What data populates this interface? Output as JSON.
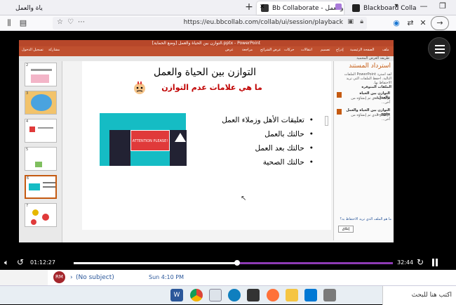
{
  "browser": {
    "tabs": [
      {
        "label": "ياة والعمل"
      },
      {
        "label": "Bb Collaborate - ياة والعمل"
      },
      {
        "label": "Blackboard Collaborate Ultra -"
      }
    ],
    "url": "https://eu.bbcollab.com/collab/ui/session/playback",
    "new_tab": "+"
  },
  "powerpoint": {
    "title_bar": "[وضع الحماية] التوازن بين الحياة والعمل.pptx - PowerPoint",
    "ribbon_tabs": [
      "ملف",
      "الصفحة الرئيسية",
      "إدراج",
      "تصميم",
      "انتقالات",
      "حركات",
      "عرض الشرائح",
      "مراجعة",
      "عرض"
    ],
    "ribbon_right": "تسجيل الدخول",
    "ribbon_share": "مشاركة",
    "protected_view": "طريقة العرض المحمية",
    "thumb_numbers": [
      "2",
      "3",
      "4",
      "5",
      "6",
      "7"
    ],
    "slide": {
      "title": "التوازن بين الحياة والعمل",
      "subtitle": "ما هي علامات عدم التوازن",
      "bullets": [
        "تعليقات الأهل وزملاء العمل",
        "حالتك بالعمل",
        "حالتك بعد العمل",
        "حالتك الصحية"
      ],
      "sign_text": "ATTENTION PLEASE!"
    },
    "pane": {
      "title": "استرداد المستند",
      "desc": "لقد استرد PowerPoint الملفات التالية. احفظ الملفات التي تريد الاحتفاظ بها.",
      "section": "الملفات المتوفرة",
      "files": [
        {
          "name": "التوازن بين الحياة والعمل...",
          "meta": "الإصدار الذي تم إنشاؤه من آخر..."
        },
        {
          "name": "التوازن بين الحياة والعمل pptx...",
          "meta": "الإصدار الذي تم إنشاؤه من آخر..."
        }
      ],
      "footer_link": "ما هو الملف الذي تريد الاحتفاظ به؟",
      "close": "إغلاق"
    }
  },
  "player": {
    "elapsed": "01:12:27",
    "duration": "32:44",
    "progress": 0.513
  },
  "chat_row": {
    "avatar": "RM",
    "subject": "(No subject)",
    "time": "Sun 4:10 PM"
  },
  "taskbar": {
    "search_placeholder": "اكتب هنا للبحث"
  }
}
